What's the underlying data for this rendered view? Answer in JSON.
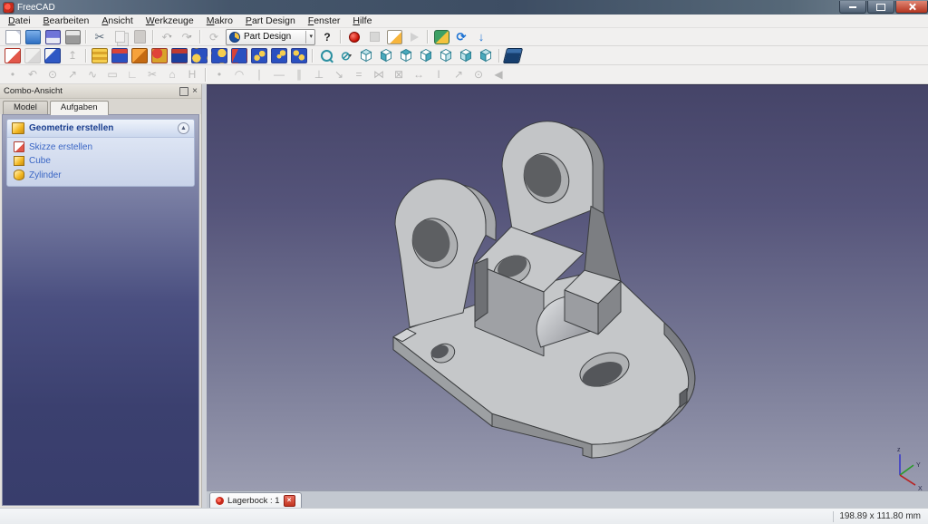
{
  "window": {
    "title": "FreeCAD",
    "controls": [
      "minimize",
      "maximize",
      "close"
    ]
  },
  "menubar": {
    "items": [
      "Datei",
      "Bearbeiten",
      "Ansicht",
      "Werkzeuge",
      "Makro",
      "Part Design",
      "Fenster",
      "Hilfe"
    ]
  },
  "toolbar_standard": {
    "icons": [
      "new-document",
      "open-document",
      "save-document",
      "print",
      "cut",
      "copy",
      "paste",
      "undo",
      "redo",
      "refresh",
      "whats-this",
      "macro-record",
      "macro-stop",
      "macro-edit",
      "macro-play",
      "python-macro",
      "web-refresh",
      "web-download"
    ],
    "glyphs": {
      "cut": "✂",
      "undo": "↶",
      "redo": "↷",
      "refresh": "⟳",
      "dropdown": "▾",
      "whatsthis": "?",
      "webrefresh": "⟳",
      "download": "↓"
    },
    "workbench_selector": {
      "value": "Part Design"
    }
  },
  "toolbar_partdesign": {
    "icons": [
      "sketch-new",
      "sketch-view",
      "sketch-map-to-face",
      "sketch-leave",
      "datum-plane",
      "pad",
      "revolution",
      "pocket",
      "groove",
      "fillet",
      "chamfer",
      "draft",
      "mirrored",
      "linear-pattern",
      "polar-pattern"
    ],
    "glyphs": {
      "sketch_leave": "↥"
    }
  },
  "toolbar_view": {
    "icons": [
      "fit-all",
      "draw-style",
      "view-axonometric",
      "view-front",
      "view-top",
      "view-right",
      "view-rear",
      "view-bottom",
      "view-left",
      "view-axo-alt",
      "part-box"
    ],
    "glyphs": {
      "drawstyle": "⊘",
      "dropdown": "▾"
    }
  },
  "toolbar_sketcher": {
    "geometry_glyphs": [
      "•",
      "↶",
      "⊙",
      "↗",
      "∿",
      "▭",
      "∟",
      "✂",
      "⌂",
      "H"
    ],
    "geometry_names": [
      "point",
      "arc",
      "circle",
      "line",
      "bspline",
      "rectangle",
      "external-geometry",
      "trim",
      "construction-mode",
      "toggle-symmetry"
    ],
    "constraint_glyphs": [
      "•",
      "◠",
      "∣",
      "―",
      "∥",
      "⊥",
      "↘",
      "=",
      "⋈",
      "⊠",
      "↔",
      "I",
      "↗",
      "⊙",
      "◀"
    ],
    "constraint_names": [
      "coincident",
      "point-on-object",
      "vertical",
      "horizontal",
      "parallel",
      "perpendicular",
      "tangent",
      "equal",
      "symmetric",
      "lock",
      "horizontal-distance",
      "vertical-distance",
      "distance",
      "radius",
      "angle"
    ]
  },
  "combo_view": {
    "title": "Combo-Ansicht",
    "close_glyph": "×",
    "tabs": [
      {
        "label": "Model",
        "active": false
      },
      {
        "label": "Aufgaben",
        "active": true
      }
    ],
    "task_box": {
      "header": "Geometrie erstellen",
      "collapse_glyph": "▲",
      "items": [
        {
          "label": "Skizze erstellen",
          "icon": "sketch-icon"
        },
        {
          "label": "Cube",
          "icon": "cube-icon"
        },
        {
          "label": "Zylinder",
          "icon": "cylinder-icon"
        }
      ]
    }
  },
  "viewport": {
    "model": "Lagerbock bearing-bracket 3D part",
    "colors": {
      "bg_top": "#454468",
      "bg_bottom": "#9a9cb0",
      "face_light": "#c5c7c9",
      "face_medium": "#9fa1a5",
      "face_dark": "#84868a",
      "outline": "#3b3d3f"
    },
    "axis": {
      "x": "X",
      "y": "Y",
      "z": "z"
    }
  },
  "document_tabs": [
    {
      "label": "Lagerbock : 1",
      "active": true,
      "close_glyph": "×"
    }
  ],
  "statusbar": {
    "dimensions": "198.89 x 111.80 mm"
  }
}
